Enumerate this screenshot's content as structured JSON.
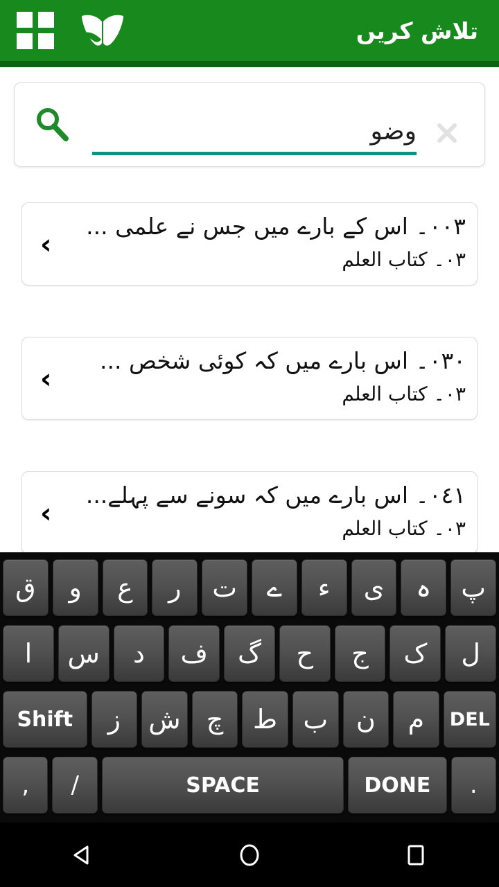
{
  "header": {
    "title": "تلاش کریں",
    "grid_icon": "grid-icon",
    "book_icon": "open-book-icon",
    "bg_color": "#188a1d",
    "accent_color": "#0c6410"
  },
  "search": {
    "value": "وضو",
    "placeholder": "",
    "search_icon": "magnifier-icon",
    "clear_icon": "close-x-icon",
    "underline_color": "#0d9383"
  },
  "results": [
    {
      "title": "۰۰۳۔ اس کے بارے میں جس نے علمی ...",
      "subtitle": "۰۳۔ کتاب العلم",
      "chevron": "‹"
    },
    {
      "title": "۰۳۰۔ اس بارے میں کہ کوئی شخص ...",
      "subtitle": "۰۳۔ کتاب العلم",
      "chevron": "‹"
    },
    {
      "title": "۰٤۱۔ اس بارے میں کہ سونے سے پہلے...",
      "subtitle": "۰۳۔ کتاب العلم",
      "chevron": "‹"
    }
  ],
  "keyboard": {
    "rows": [
      {
        "keys": [
          {
            "label": "ق",
            "type": "char"
          },
          {
            "label": "و",
            "type": "char"
          },
          {
            "label": "ع",
            "type": "char"
          },
          {
            "label": "ر",
            "type": "char"
          },
          {
            "label": "ت",
            "type": "char"
          },
          {
            "label": "ے",
            "type": "char"
          },
          {
            "label": "ء",
            "type": "char"
          },
          {
            "label": "ی",
            "type": "char"
          },
          {
            "label": "ہ",
            "type": "char"
          },
          {
            "label": "پ",
            "type": "char"
          }
        ]
      },
      {
        "keys": [
          {
            "label": "ا",
            "type": "char"
          },
          {
            "label": "س",
            "type": "char"
          },
          {
            "label": "د",
            "type": "char"
          },
          {
            "label": "ف",
            "type": "char"
          },
          {
            "label": "گ",
            "type": "char"
          },
          {
            "label": "ح",
            "type": "char"
          },
          {
            "label": "ج",
            "type": "char"
          },
          {
            "label": "ک",
            "type": "char"
          },
          {
            "label": "ل",
            "type": "char"
          }
        ]
      },
      {
        "keys": [
          {
            "label": "Shift",
            "type": "shift"
          },
          {
            "label": "ز",
            "type": "char"
          },
          {
            "label": "ش",
            "type": "char"
          },
          {
            "label": "چ",
            "type": "char"
          },
          {
            "label": "ط",
            "type": "char"
          },
          {
            "label": "ب",
            "type": "char"
          },
          {
            "label": "ن",
            "type": "char"
          },
          {
            "label": "م",
            "type": "char"
          },
          {
            "label": "DEL",
            "type": "del"
          }
        ]
      },
      {
        "keys": [
          {
            "label": ",",
            "type": "punct"
          },
          {
            "label": "/",
            "type": "punct"
          },
          {
            "label": "SPACE",
            "type": "space"
          },
          {
            "label": "DONE",
            "type": "done"
          },
          {
            "label": ".",
            "type": "punct"
          }
        ]
      }
    ]
  },
  "navbar": {
    "back": "back-triangle-icon",
    "home": "home-circle-icon",
    "recents": "recents-square-icon"
  }
}
